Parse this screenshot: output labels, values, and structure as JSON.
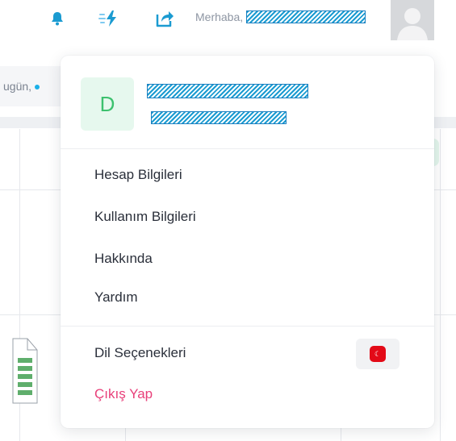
{
  "colors": {
    "accent": "#1b9bd1",
    "logout": "#e8407a",
    "initial_bg": "#e6f8ee",
    "initial_fg": "#3cc16e",
    "flag": "#e30a17"
  },
  "topbar": {
    "notification_icon": "bell-icon",
    "activity_icon": "flash-icon",
    "share_icon": "share-icon",
    "greeting": "Merhaba,",
    "avatar_icon": "user-avatar-icon"
  },
  "background": {
    "search_text": "ugün,"
  },
  "dropdown": {
    "user": {
      "initial": "D"
    },
    "menu": [
      {
        "label": "Hesap Bilgileri"
      },
      {
        "label": "Kullanım Bilgileri"
      },
      {
        "label": "Hakkında"
      },
      {
        "label": "Yardım"
      }
    ],
    "language_label": "Dil Seçenekleri",
    "language_flag": "turkey-flag-icon",
    "logout_label": "Çıkış Yap"
  }
}
